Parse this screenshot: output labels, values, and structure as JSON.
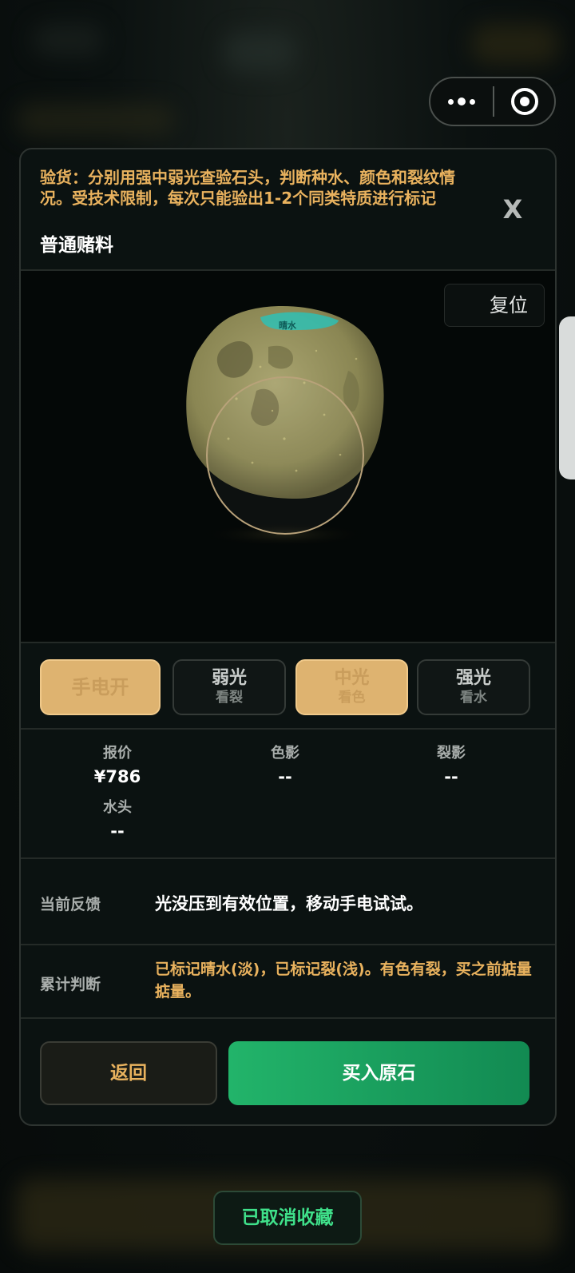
{
  "capsule": {
    "more_icon": "more-dots-icon",
    "close_icon": "target-circle-icon"
  },
  "header": {
    "description": "验货：分别用强中弱光查验石头，判断种水、颜色和裂纹情况。受技术限制，每次只能验出1-2个同类特质进行标记",
    "title": "普通赌料",
    "close_label": "X"
  },
  "stage": {
    "reset_label": "复位",
    "stone_mark_text": "晴水",
    "colors": {
      "stone": "#9a9560",
      "mark": "#22c7c0",
      "ring": "#b9a27a"
    }
  },
  "lights": [
    {
      "main": "手电开",
      "sub": "",
      "active": true
    },
    {
      "main": "弱光",
      "sub": "看裂",
      "active": false
    },
    {
      "main": "中光",
      "sub": "看色",
      "active": true
    },
    {
      "main": "强光",
      "sub": "看水",
      "active": false
    }
  ],
  "stats": [
    {
      "label": "报价",
      "value": "¥786"
    },
    {
      "label": "色影",
      "value": "--"
    },
    {
      "label": "裂影",
      "value": "--"
    },
    {
      "label": "水头",
      "value": "--"
    }
  ],
  "feedback": {
    "label": "当前反馈",
    "text": "光没压到有效位置，移动手电试试。"
  },
  "judge": {
    "label": "累计判断",
    "text": "已标记晴水(淡)，已标记裂(浅)。有色有裂，买之前掂量掂量。"
  },
  "actions": {
    "back_label": "返回",
    "buy_label": "买入原石"
  },
  "toast": {
    "text": "已取消收藏"
  },
  "colors": {
    "accent_gold": "#e9b25e",
    "accent_green": "#22b46a",
    "toast_green": "#3fe08a"
  }
}
